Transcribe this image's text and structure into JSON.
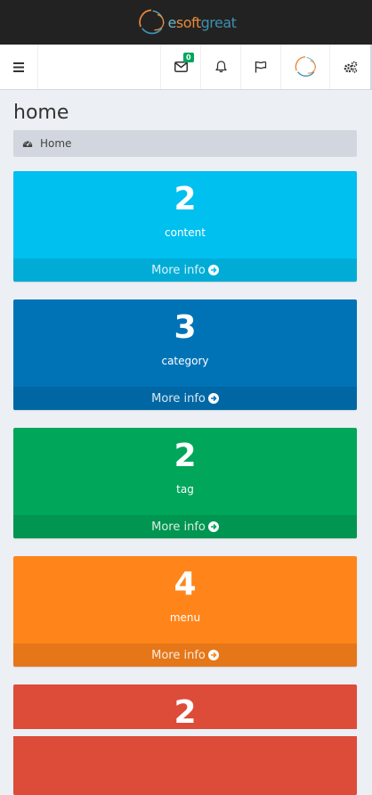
{
  "logo": {
    "part1": "e",
    "part2": "soft",
    "part3": "great"
  },
  "navbar": {
    "mail_badge": "0"
  },
  "page": {
    "title": "home",
    "breadcrumb": "Home"
  },
  "boxes": [
    {
      "number": "2",
      "label": "content",
      "footer": "More info",
      "color": "#00c0ef"
    },
    {
      "number": "3",
      "label": "category",
      "footer": "More info",
      "color": "#0073b7"
    },
    {
      "number": "2",
      "label": "tag",
      "footer": "More info",
      "color": "#00a65a"
    },
    {
      "number": "4",
      "label": "menu",
      "footer": "More info",
      "color": "#ff851b"
    },
    {
      "number": "2",
      "label": "",
      "footer": "",
      "color": "#dd4b39"
    }
  ],
  "icons": {
    "menu": "hamburger-icon",
    "mail": "envelope-icon",
    "notifications": "bell-icon",
    "tasks": "flag-icon",
    "user": "avatar",
    "settings": "gears-icon",
    "breadcrumb": "dashboard-icon",
    "footer_arrow": "arrow-circle-right-icon"
  }
}
